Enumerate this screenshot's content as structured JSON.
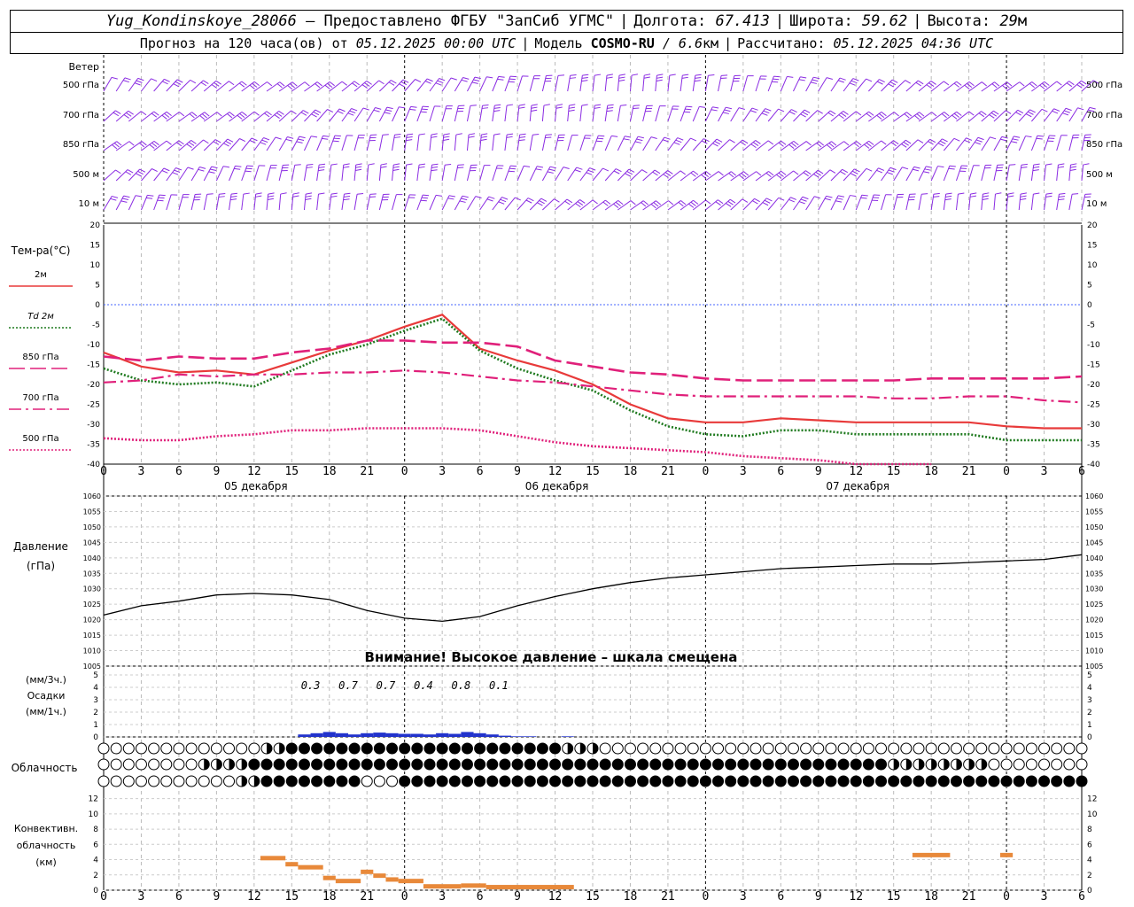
{
  "header": {
    "station": "Yug_Kondinskoye_28066",
    "provided": "– Предоставлено ФГБУ \"ЗапСиб УГМС\"",
    "lon_label": "Долгота:",
    "lon": "67.413",
    "lat_label": "Широта:",
    "lat": "59.62",
    "alt_label": "Высота:",
    "alt": "29",
    "alt_unit": "м",
    "forecast_prefix": "Прогноз на 120 часа(ов) от",
    "forecast_start": "05.12.2025 00:00 UTC",
    "model_label": "Модель",
    "model": "COSMO-RU",
    "resolution": "/ 6.6",
    "res_unit": "км",
    "calc_label": "Рассчитано:",
    "calc_time": "05.12.2025 04:36 UTC"
  },
  "wind_panel": {
    "title": "Ветер",
    "levels": [
      "500 гПа",
      "700 гПа",
      "850 гПа",
      "500 м",
      "10 м"
    ],
    "barb_color": "#8a2be2"
  },
  "temp_panel": {
    "title": "Тем-ра(°C)",
    "legend": [
      {
        "label": "2м",
        "color": "#e83a3a",
        "style": "solid"
      },
      {
        "label": "Td 2м",
        "color": "#1f7a1f",
        "style": "dotted"
      },
      {
        "label": "850 гПа",
        "color": "#e0207a",
        "style": "longdash"
      },
      {
        "label": "700 гПа",
        "color": "#e0207a",
        "style": "dashdot"
      },
      {
        "label": "500 гПа",
        "color": "#e0207a",
        "style": "dotted"
      }
    ],
    "yticks": [
      20,
      15,
      10,
      5,
      0,
      -5,
      -10,
      -15,
      -20,
      -25,
      -30,
      -35,
      -40
    ]
  },
  "time_axis": {
    "ticks": [
      "0",
      "3",
      "6",
      "9",
      "12",
      "15",
      "18",
      "21",
      "0",
      "3",
      "6",
      "9",
      "12",
      "15",
      "18",
      "21",
      "0",
      "3",
      "6",
      "9",
      "12",
      "15",
      "18",
      "21",
      "0",
      "3",
      "6"
    ],
    "days": [
      "05 декабря",
      "06 декабря",
      "07 декабря"
    ]
  },
  "pressure_panel": {
    "title": "Давление",
    "unit": "(гПа)",
    "yticks": [
      1060,
      1055,
      1050,
      1045,
      1040,
      1035,
      1030,
      1025,
      1020,
      1015,
      1010,
      1005
    ],
    "warning": "Внимание! Высокое давление – шкала смещена"
  },
  "precip_panel": {
    "unit_top": "(мм/3ч.)",
    "title": "Осадки",
    "unit_bottom": "(мм/1ч.)",
    "yticks": [
      5,
      4,
      3,
      2,
      1,
      0
    ],
    "totals": [
      "0.3",
      "0.7",
      "0.7",
      "0.4",
      "0.8",
      "0.1"
    ]
  },
  "cloud_panel": {
    "title": "Облачность"
  },
  "conv_panel": {
    "title1": "Конвективн.",
    "title2": "облачность",
    "unit": "(км)",
    "yticks": [
      12,
      10,
      8,
      6,
      4,
      2,
      0
    ]
  },
  "chart_data": [
    {
      "type": "line",
      "title": "Тем-ра(°C)",
      "x_hours": [
        0,
        3,
        6,
        9,
        12,
        15,
        18,
        21,
        24,
        27,
        30,
        33,
        36,
        39,
        42,
        45,
        48,
        51,
        54,
        57,
        60,
        63,
        66,
        69,
        72,
        75,
        78
      ],
      "ylim": [
        -40,
        20
      ],
      "series": [
        {
          "name": "2м",
          "values": [
            -12,
            -15.5,
            -17,
            -16.5,
            -17.5,
            -14.5,
            -11.5,
            -9,
            -5.5,
            -2.5,
            -11,
            -14,
            -16.5,
            -20,
            -25,
            -28.5,
            -29.5,
            -29.5,
            -28.5,
            -29,
            -29.5,
            -29.5,
            -29.5,
            -29.5,
            -30.5,
            -31,
            -31
          ]
        },
        {
          "name": "Td 2м",
          "values": [
            -16,
            -19,
            -20,
            -19.5,
            -20.5,
            -16.5,
            -12.5,
            -10,
            -6.5,
            -3.5,
            -11.5,
            -16,
            -19,
            -21.5,
            -26.5,
            -30.5,
            -32.5,
            -33,
            -31.5,
            -31.5,
            -32.5,
            -32.5,
            -32.5,
            -32.5,
            -34,
            -34,
            -34
          ]
        },
        {
          "name": "850 гПа",
          "values": [
            -13,
            -14,
            -13,
            -13.5,
            -13.5,
            -12,
            -11,
            -9,
            -9,
            -9.5,
            -9.5,
            -10.5,
            -14,
            -15.5,
            -17,
            -17.5,
            -18.5,
            -19,
            -19,
            -19,
            -19,
            -19,
            -18.5,
            -18.5,
            -18.5,
            -18.5,
            -18
          ]
        },
        {
          "name": "700 гПа",
          "values": [
            -19.5,
            -19,
            -17.5,
            -18,
            -17.5,
            -17.5,
            -17,
            -17,
            -16.5,
            -17,
            -18,
            -19,
            -19.5,
            -20.5,
            -21.5,
            -22.5,
            -23,
            -23,
            -23,
            -23,
            -23,
            -23.5,
            -23.5,
            -23,
            -23,
            -24,
            -24.5
          ]
        },
        {
          "name": "500 гПа",
          "values": [
            -33.5,
            -34,
            -34,
            -33,
            -32.5,
            -31.5,
            -31.5,
            -31,
            -31,
            -31,
            -31.5,
            -33,
            -34.5,
            -35.5,
            -36,
            -36.5,
            -37,
            -38,
            -38.5,
            -39,
            -40,
            -40,
            -40,
            null,
            null,
            null,
            null
          ]
        }
      ]
    },
    {
      "type": "line",
      "title": "Давление (гПа)",
      "x_hours": [
        0,
        3,
        6,
        9,
        12,
        15,
        18,
        21,
        24,
        27,
        30,
        33,
        36,
        39,
        42,
        45,
        48,
        51,
        54,
        57,
        60,
        63,
        66,
        69,
        72,
        75,
        78
      ],
      "ylim": [
        1005,
        1060
      ],
      "series": [
        {
          "name": "",
          "values": [
            1021.5,
            1024.5,
            1026,
            1028,
            1028.5,
            1028,
            1026.5,
            1023,
            1020.5,
            1019.5,
            1021,
            1024.5,
            1027.5,
            1030,
            1032,
            1033.5,
            1034.5,
            1035.5,
            1036.5,
            1037,
            1037.5,
            1038,
            1038,
            1038.5,
            1039,
            1039.5,
            1041
          ]
        }
      ]
    },
    {
      "type": "bar",
      "title": "Осадки (мм/1ч.)",
      "x_hours": [
        16,
        17,
        18,
        19,
        20,
        21,
        22,
        23,
        24,
        25,
        26,
        27,
        28,
        29,
        30,
        31,
        32,
        33,
        34,
        37
      ],
      "ylim": [
        0,
        5
      ],
      "series": [
        {
          "name": "",
          "values": [
            0.2,
            0.3,
            0.4,
            0.3,
            0.2,
            0.3,
            0.35,
            0.3,
            0.25,
            0.25,
            0.2,
            0.3,
            0.25,
            0.4,
            0.3,
            0.2,
            0.1,
            0.05,
            0.05,
            0.05
          ]
        }
      ]
    },
    {
      "type": "bar",
      "title": "Конвективн. облачность (км)",
      "segments": [
        {
          "start": 12.5,
          "end": 14.5,
          "base": 4.2
        },
        {
          "start": 14.5,
          "end": 15.5,
          "base": 3.4
        },
        {
          "start": 15.5,
          "end": 17.5,
          "base": 3.0
        },
        {
          "start": 17.5,
          "end": 18.5,
          "base": 1.6
        },
        {
          "start": 18.5,
          "end": 20.5,
          "base": 1.2
        },
        {
          "start": 20.5,
          "end": 21.5,
          "base": 2.4
        },
        {
          "start": 21.5,
          "end": 22.5,
          "base": 1.9
        },
        {
          "start": 22.5,
          "end": 23.5,
          "base": 1.4
        },
        {
          "start": 23.5,
          "end": 25.5,
          "base": 1.2
        },
        {
          "start": 25.5,
          "end": 28.5,
          "base": 0.5
        },
        {
          "start": 28.5,
          "end": 30.5,
          "base": 0.6
        },
        {
          "start": 30.5,
          "end": 37.5,
          "base": 0.4
        },
        {
          "start": 64.5,
          "end": 67.5,
          "base": 4.6
        },
        {
          "start": 71.5,
          "end": 72.5,
          "base": 4.6
        }
      ]
    }
  ]
}
